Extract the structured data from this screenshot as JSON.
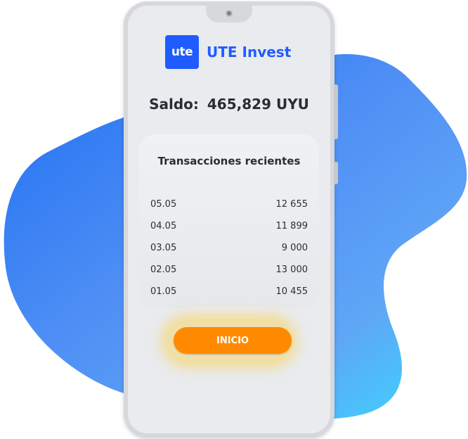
{
  "brand": {
    "logo_text": "ute",
    "name": "UTE Invest",
    "color": "#1f5bff"
  },
  "balance": {
    "label": "Saldo:",
    "value": "465,829 UYU"
  },
  "transactions": {
    "title": "Transacciones recientes",
    "rows": [
      {
        "date": "05.05",
        "amount": "12 655"
      },
      {
        "date": "04.05",
        "amount": "11 899"
      },
      {
        "date": "03.05",
        "amount": "9 000"
      },
      {
        "date": "02.05",
        "amount": "13 000"
      },
      {
        "date": "01.05",
        "amount": "10 455"
      }
    ]
  },
  "cta": {
    "label": "INICIO",
    "color": "#ff8a00"
  }
}
